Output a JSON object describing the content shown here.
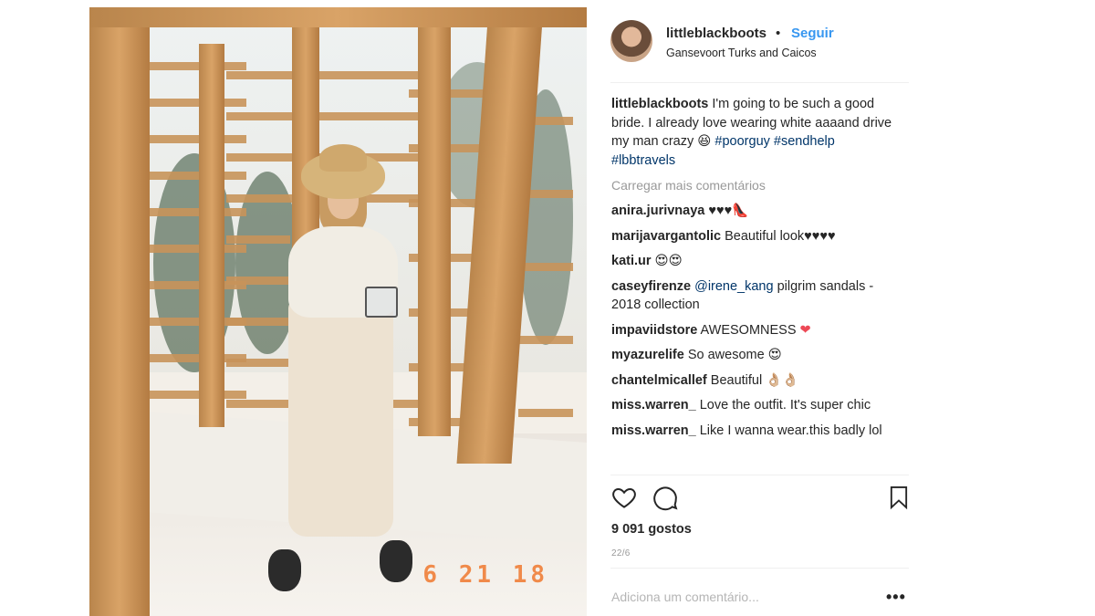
{
  "photo": {
    "date_stamp": "6 21 18"
  },
  "post": {
    "author": "littleblackboots",
    "separator": "•",
    "follow_label": "Seguir",
    "location": "Gansevoort Turks and Caicos",
    "caption_user": "littleblackboots",
    "caption_text": " I'm going to be such a good bride. I already love wearing white aaaand drive my man crazy 😆 ",
    "caption_tags": [
      "#poorguy",
      "#sendhelp",
      "#lbbtravels"
    ],
    "load_more": "Carregar mais comentários",
    "comments": [
      {
        "user": "anira.jurivnaya",
        "text": " ♥♥♥👠"
      },
      {
        "user": "marijavargantolic",
        "text": " Beautiful look♥♥♥♥"
      },
      {
        "user": "kati.ur",
        "text": " 😍😍"
      },
      {
        "user": "caseyfirenze",
        "mention": "@irene_kang",
        "text": " pilgrim sandals - 2018 collection"
      },
      {
        "user": "impaviidstore",
        "text": " AWESOMNESS ",
        "emoji": "❤"
      },
      {
        "user": "myazurelife",
        "text": " So awesome 😍"
      },
      {
        "user": "chantelmicallef",
        "text": " Beautiful 👌🏼👌🏼"
      },
      {
        "user": "miss.warren_",
        "text": " Love the outfit. It's super chic"
      },
      {
        "user": "miss.warren_",
        "text": " Like I wanna wear.this badly lol"
      }
    ],
    "likes": "9 091 gostos",
    "date": "22/6",
    "add_comment_placeholder": "Adiciona um comentário...",
    "more_label": "•••"
  },
  "icons": {
    "like": "heart-icon",
    "comment": "comment-bubble-icon",
    "save": "bookmark-icon",
    "more": "more-options-icon"
  },
  "colors": {
    "follow": "#3897f0",
    "hashtag": "#003569",
    "muted": "#999999",
    "heart": "#ed4956"
  }
}
